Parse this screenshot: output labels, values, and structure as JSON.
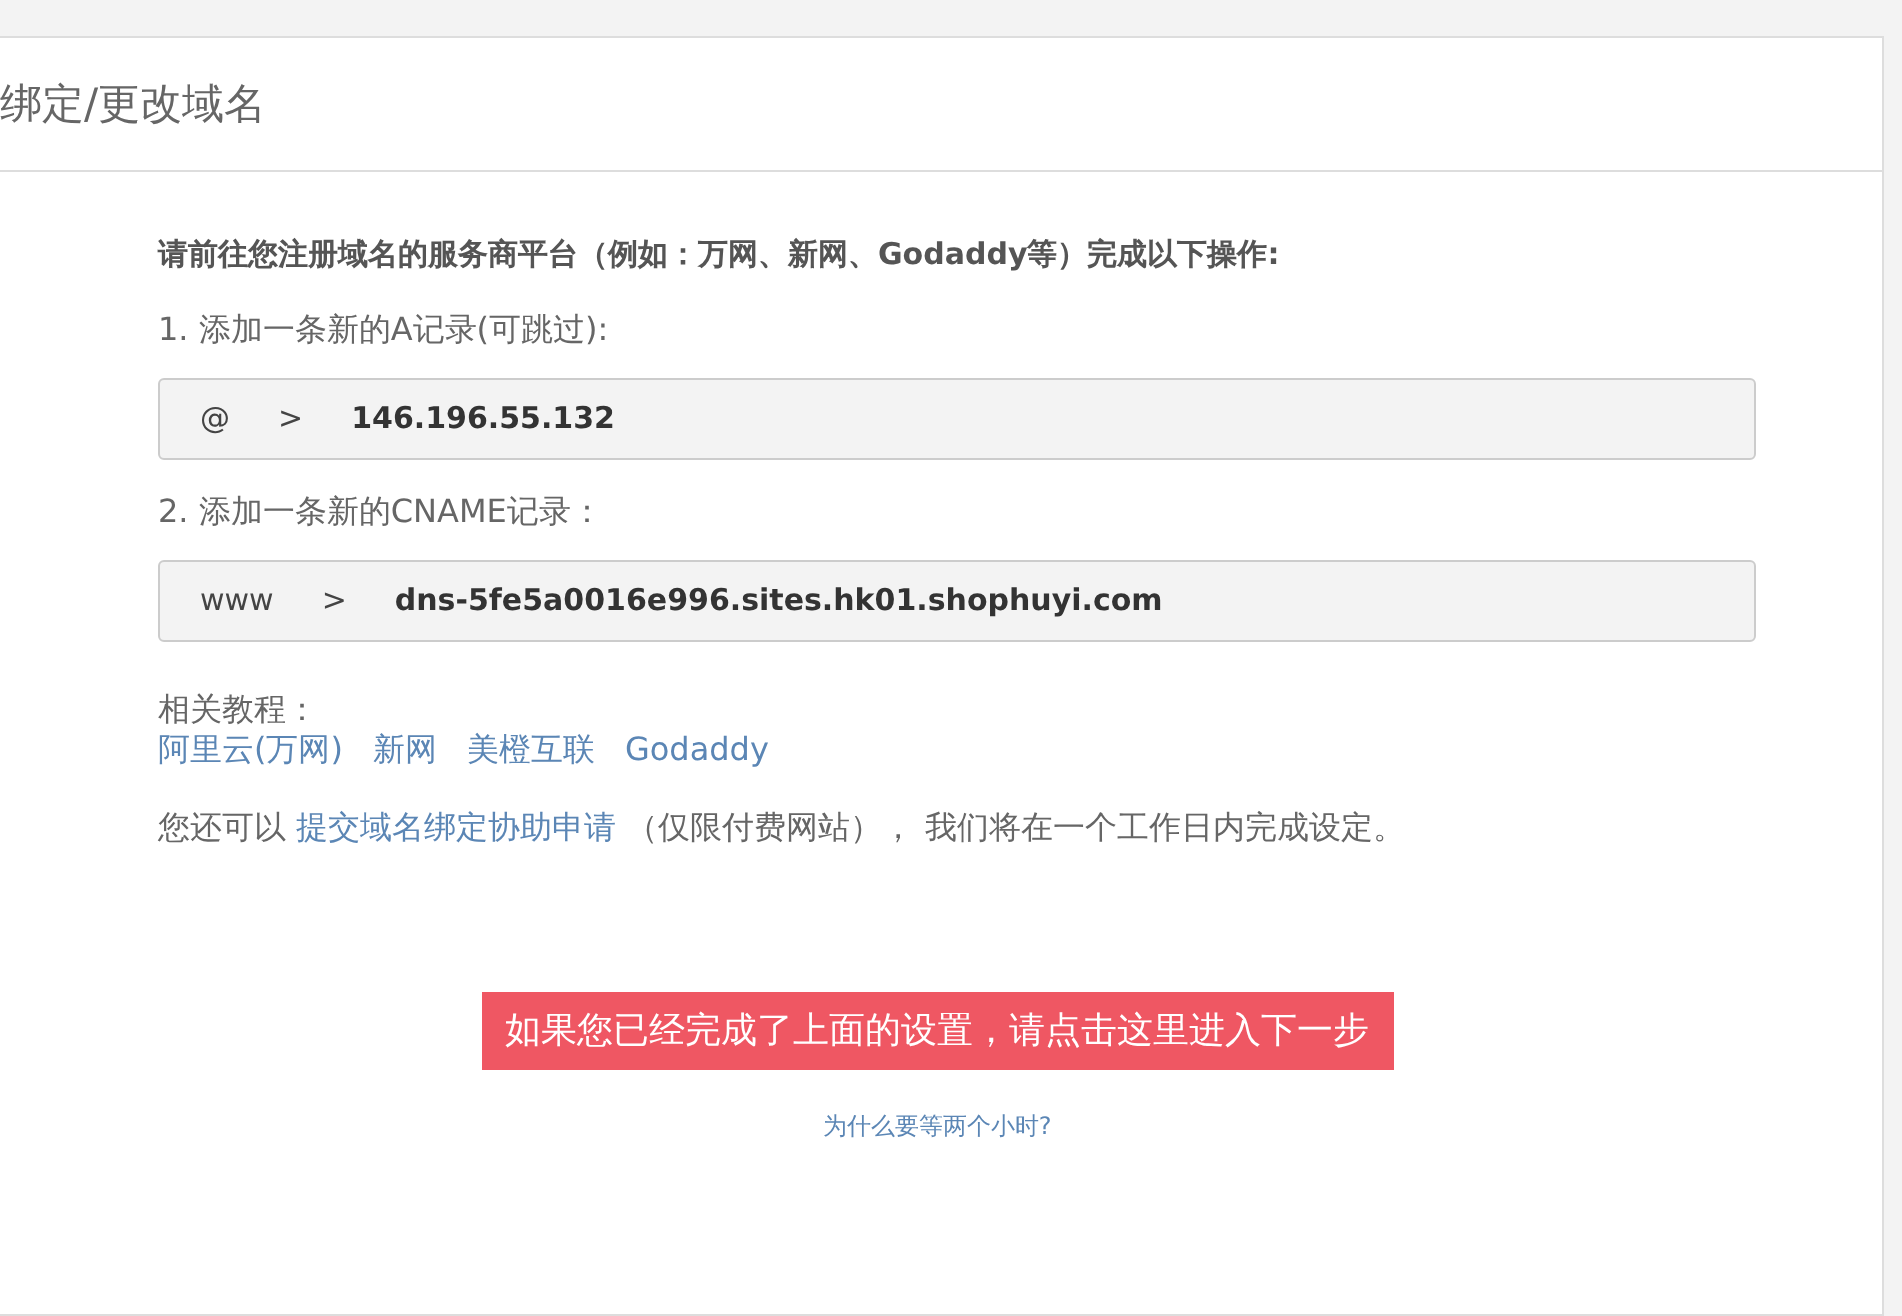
{
  "panel": {
    "title": "绑定/更改域名"
  },
  "instruction": "请前往您注册域名的服务商平台（例如：万网、新网、Godaddy等）完成以下操作:",
  "records": [
    {
      "step": "1. 添加一条新的A记录(可跳过):",
      "host": "@",
      "arrow": ">",
      "value": "146.196.55.132"
    },
    {
      "step": "2. 添加一条新的CNAME记录：",
      "host": "www",
      "arrow": ">",
      "value": "dns-5fe5a0016e996.sites.hk01.shophuyi.com"
    }
  ],
  "tutorials": {
    "label": "相关教程：",
    "links": [
      "阿里云(万网)",
      "新网",
      "美橙互联",
      "Godaddy"
    ]
  },
  "help": {
    "before": "您还可以 ",
    "link": "提交域名绑定协助申请",
    "after": " （仅限付费网站）， 我们将在一个工作日内完成设定。"
  },
  "next_button": "如果您已经完成了上面的设置，请点击这里进入下一步",
  "why_link": "为什么要等两个小时?"
}
